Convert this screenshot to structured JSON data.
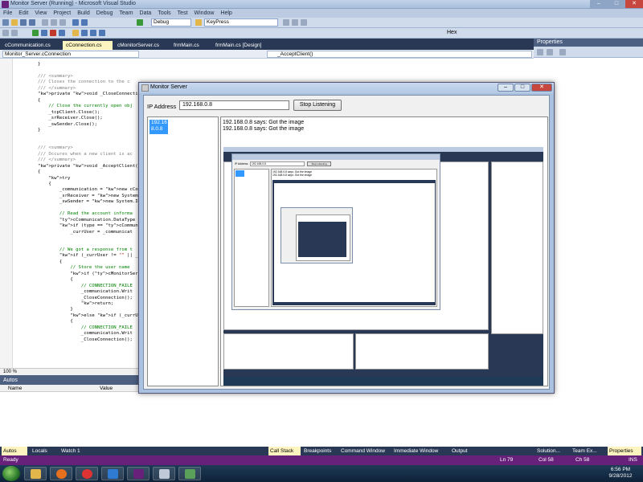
{
  "vs": {
    "title": "Monitor Server (Running) - Microsoft Visual Studio",
    "menu": [
      "File",
      "Edit",
      "View",
      "Project",
      "Build",
      "Debug",
      "Team",
      "Data",
      "Tools",
      "Test",
      "Window",
      "Help"
    ],
    "config_combo": "Debug",
    "find_combo": "KeyPress",
    "hex_label": "Hex",
    "doc_tabs": [
      "cCommunication.cs",
      "cConnection.cs",
      "cMonitorServer.cs",
      "frmMain.cs",
      "frmMain.cs [Design]"
    ],
    "nav_left": "Monitor_Server.cConnection",
    "nav_right": "_AcceptClient()",
    "code_lines": [
      "        }",
      "",
      "        /// <summary>",
      "        /// Closes the connection to the c",
      "        /// </summary>",
      "        private void _CloseConnection()",
      "        {",
      "            // Close the currently open obj",
      "            _tcpClient.Close();",
      "            _srReceiver.Close();",
      "            _swSender.Close();",
      "        }",
      "",
      "",
      "        /// <summary>",
      "        /// Occures when a new client is ac",
      "        /// </summary>",
      "        private void _AcceptClient()",
      "        {",
      "            try",
      "            {",
      "                _communication = new cComm",
      "                _srReceiver = new System.IO",
      "                _swSender = new System.IO.S",
      "",
      "                // Read the account informa",
      "                cCommunication.DataType typ",
      "                if (type == cCommunication.",
      "                    _currUser = _communicat",
      "",
      "",
      "                // We got a response from t",
      "                if (_currUser != \"\" || _cur",
      "                {",
      "                    // Store the user name",
      "                    if (cMonitorServer.htUs",
      "                    {",
      "                        // CONNECTION_FAILE",
      "                        _communication.Writ",
      "                        _CloseConnection();",
      "                        return;",
      "                    }",
      "                    else if (_currUser.ToLo",
      "                    {",
      "                        // CONNECTION_FAILE",
      "                        _communication.Writ",
      "                        _CloseConnection();"
    ],
    "zoom": "100 %",
    "autos_title": "Autos",
    "autos_cols": [
      "Name",
      "Value"
    ],
    "properties_title": "Properties",
    "bottom_tabs_left": [
      "Autos",
      "Locals",
      "Watch 1"
    ],
    "bottom_tabs_mid": [
      "Call Stack",
      "Breakpoints",
      "Command Window",
      "Immediate Window",
      "Output"
    ],
    "bottom_tabs_right": [
      "Solution...",
      "Team Ex...",
      "Properties"
    ],
    "status": {
      "left": "Ready",
      "ln": "Ln 79",
      "col": "Col 58",
      "ch": "Ch 58",
      "ins": "INS"
    }
  },
  "monitor": {
    "title": "Monitor Server",
    "ip_label": "IP Address",
    "ip_value": "192.168.0.8",
    "stop_button": "Stop Listening",
    "clients": [
      "192.16\n8.0.8"
    ],
    "messages": [
      "192.168.0.8 says: Got the image",
      "192.168.0.8 says: Got the image"
    ],
    "nested_ip": "192.168.0.8",
    "nested_stop": "Stop Listening"
  },
  "taskbar": {
    "time": "6:56 PM",
    "date": "9/28/2012"
  },
  "colors": {
    "vs_frame": "#293955",
    "vs_status": "#68217a",
    "selection": "#3399ff",
    "active_tab": "#fdf4bf"
  }
}
